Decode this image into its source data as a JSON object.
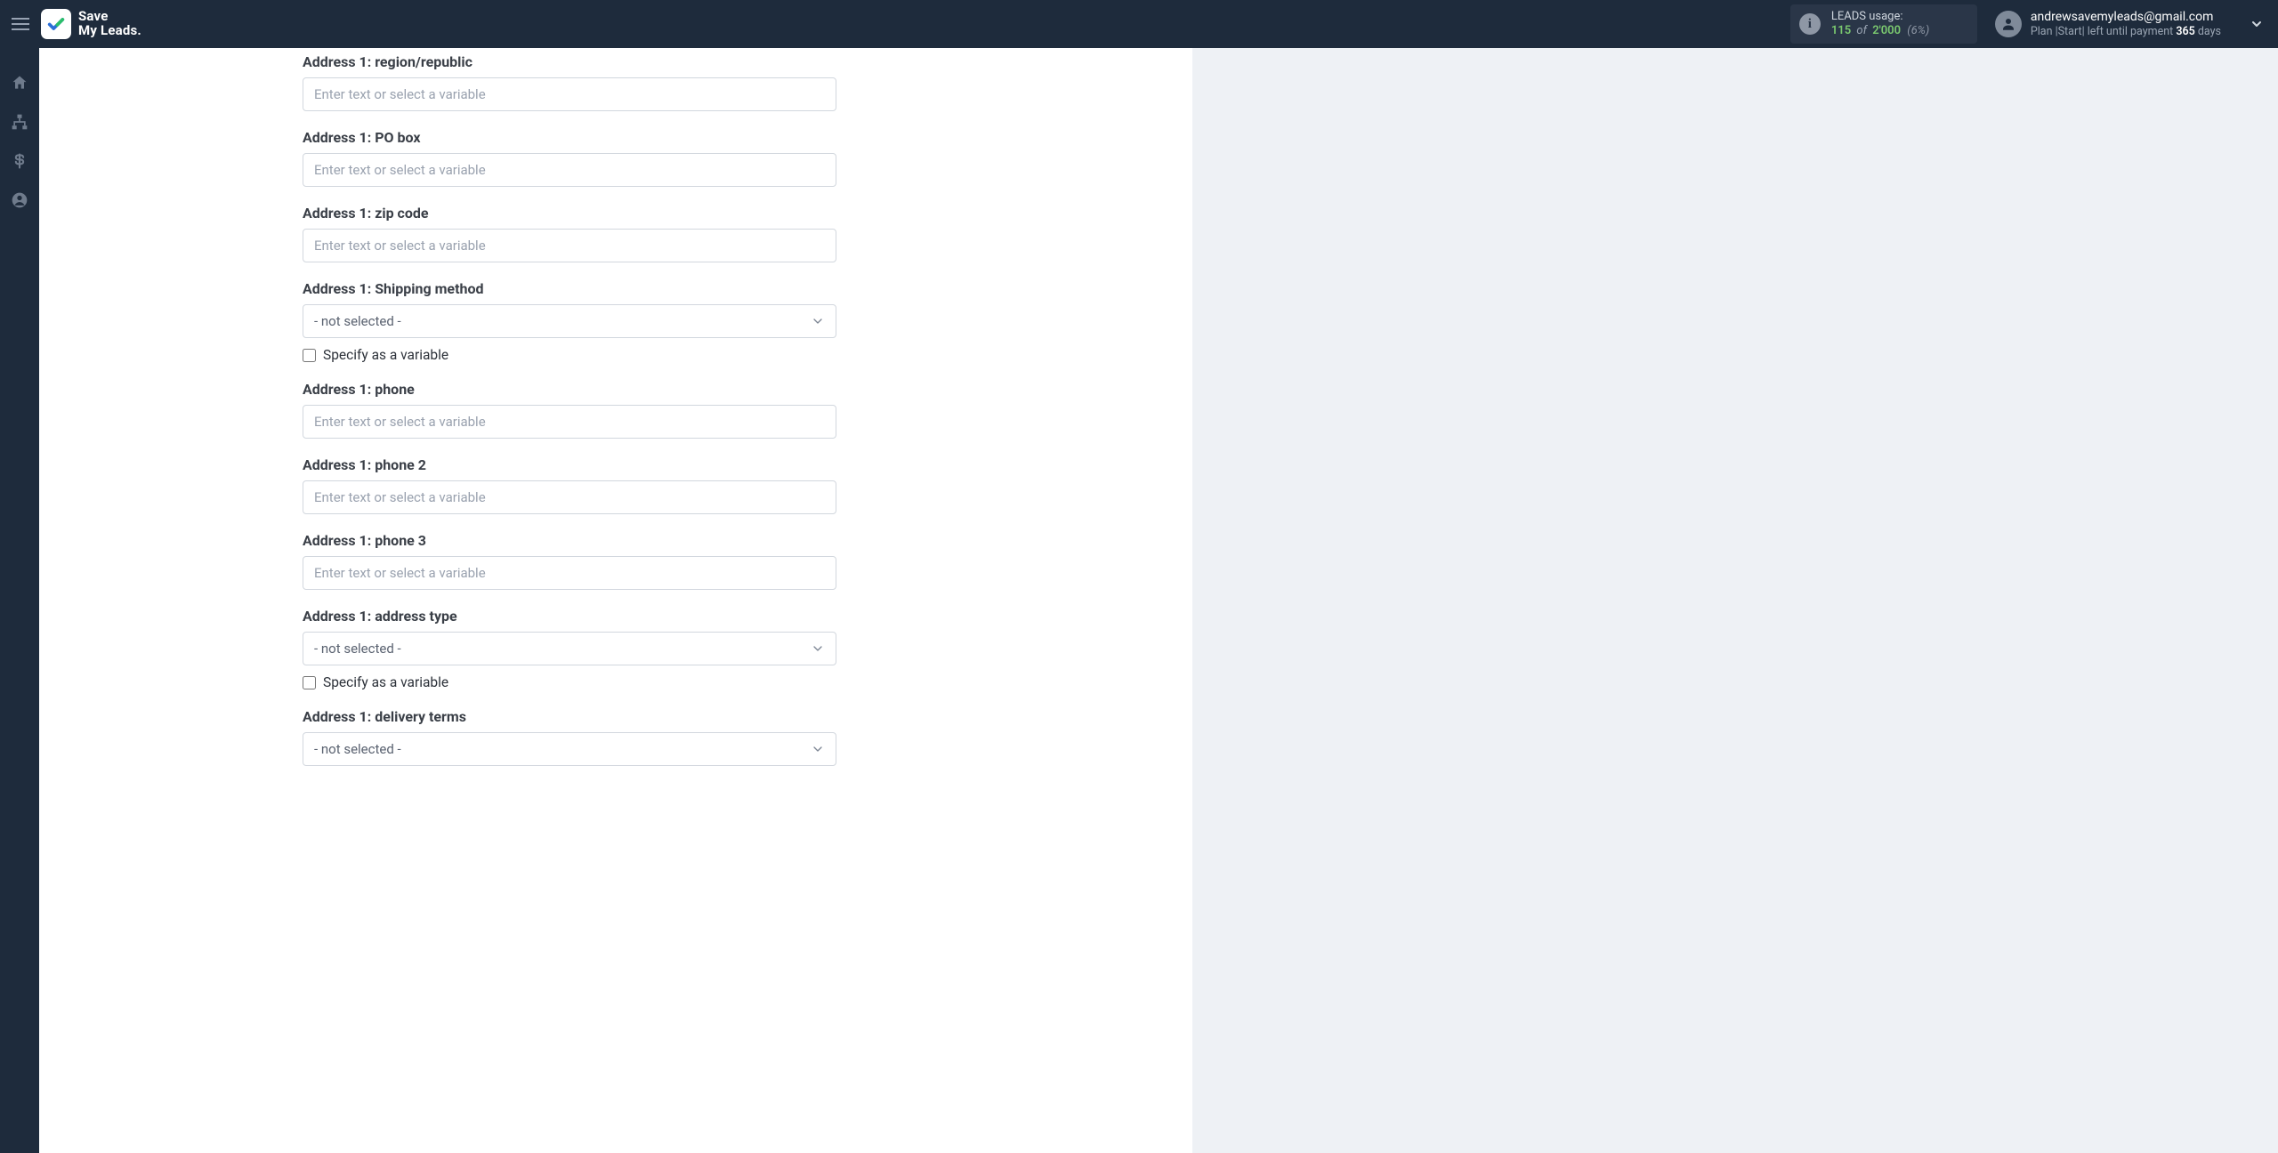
{
  "brand": {
    "line1": "Save",
    "line2": "My Leads."
  },
  "usage": {
    "title": "LEADS usage:",
    "used": "115",
    "of": "of",
    "total": "2'000",
    "pct": "(6%)"
  },
  "account": {
    "email": "andrewsavemyleads@gmail.com",
    "plan_prefix": "Plan |Start| left until payment ",
    "days": "365",
    "days_suffix": " days"
  },
  "placeholder_text": "Enter text or select a variable",
  "select_not_selected": "- not selected -",
  "specify_variable_label": "Specify as a variable",
  "fields": {
    "region": {
      "label": "Address 1: region/republic"
    },
    "pobox": {
      "label": "Address 1: PO box"
    },
    "zip": {
      "label": "Address 1: zip code"
    },
    "shipping": {
      "label": "Address 1: Shipping method"
    },
    "phone": {
      "label": "Address 1: phone"
    },
    "phone2": {
      "label": "Address 1: phone 2"
    },
    "phone3": {
      "label": "Address 1: phone 3"
    },
    "addrtype": {
      "label": "Address 1: address type"
    },
    "delivery": {
      "label": "Address 1: delivery terms"
    }
  }
}
